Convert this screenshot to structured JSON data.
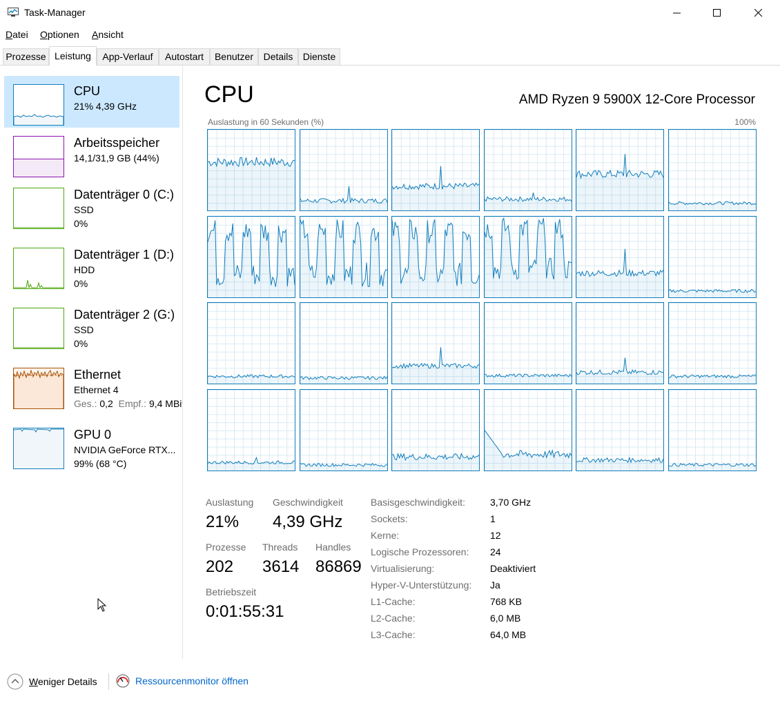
{
  "window": {
    "title": "Task-Manager"
  },
  "menu": [
    {
      "label": "Datei",
      "u": "D",
      "rest": "atei"
    },
    {
      "label": "Optionen",
      "u": "O",
      "rest": "ptionen"
    },
    {
      "label": "Ansicht",
      "u": "A",
      "rest": "nsicht"
    }
  ],
  "tabs": [
    "Prozesse",
    "Leistung",
    "App-Verlauf",
    "Autostart",
    "Benutzer",
    "Details",
    "Dienste"
  ],
  "active_tab": "Leistung",
  "sidebar": {
    "items": [
      {
        "title": "CPU",
        "line1": "21% 4,39 GHz",
        "color": "#117dbb"
      },
      {
        "title": "Arbeitsspeicher",
        "line1": "14,1/31,9 GB (44%)",
        "color": "#8b12ae"
      },
      {
        "title": "Datenträger 0 (C:)",
        "line1": "SSD",
        "line2": "0%",
        "color": "#4da60c"
      },
      {
        "title": "Datenträger 1 (D:)",
        "line1": "HDD",
        "line2": "0%",
        "color": "#4da60c"
      },
      {
        "title": "Datenträger 2 (G:)",
        "line1": "SSD",
        "line2": "0%",
        "color": "#4da60c"
      },
      {
        "title": "Ethernet",
        "line1": "Ethernet 4",
        "line2a": "Ges.: ",
        "line2b": "0,2",
        "line2c": "  Empf.: ",
        "line2d": "9,4 MBit",
        "color": "#a74f01"
      },
      {
        "title": "GPU 0",
        "line1": "NVIDIA GeForce RTX...",
        "line2": "99% (68 °C)",
        "color": "#117dbb"
      }
    ]
  },
  "main": {
    "title": "CPU",
    "processor": "AMD Ryzen 9 5900X 12-Core Processor",
    "graph_label": "Auslastung in 60 Sekunden (%)",
    "graph_max": "100%",
    "accent": "#117dbb"
  },
  "stats": {
    "usage_label": "Auslastung",
    "usage": "21%",
    "speed_label": "Geschwindigkeit",
    "speed": "4,39 GHz",
    "proc_label": "Prozesse",
    "proc": "202",
    "threads_label": "Threads",
    "threads": "3614",
    "handles_label": "Handles",
    "handles": "86869",
    "uptime_label": "Betriebszeit",
    "uptime": "0:01:55:31"
  },
  "details": [
    {
      "k": "Basisgeschwindigkeit:",
      "v": "3,70 GHz"
    },
    {
      "k": "Sockets:",
      "v": "1"
    },
    {
      "k": "Kerne:",
      "v": "12"
    },
    {
      "k": "Logische Prozessoren:",
      "v": "24"
    },
    {
      "k": "Virtualisierung:",
      "v": "Deaktiviert"
    },
    {
      "k": "Hyper-V-Unterstützung:",
      "v": "Ja"
    },
    {
      "k": "L1-Cache:",
      "v": "768 KB"
    },
    {
      "k": "L2-Cache:",
      "v": "6,0 MB"
    },
    {
      "k": "L3-Cache:",
      "v": "64,0 MB"
    }
  ],
  "footer": {
    "less_details": "Weniger Details",
    "less_u": "W",
    "less_rest": "eniger Details",
    "resmon": "Ressourcenmonitor öffnen"
  },
  "core_levels": [
    {
      "base": 60,
      "noise": 6,
      "spike": null
    },
    {
      "base": 12,
      "noise": 3,
      "spike": 30
    },
    {
      "base": 30,
      "noise": 4,
      "spike": 55
    },
    {
      "base": 14,
      "noise": 3,
      "spike": 22
    },
    {
      "base": 45,
      "noise": 5,
      "spike": 70
    },
    {
      "base": 9,
      "noise": 2,
      "spike": null
    },
    {
      "base": 55,
      "noise": 30,
      "spike": null,
      "wave": true
    },
    {
      "base": 55,
      "noise": 30,
      "spike": null,
      "wave": true
    },
    {
      "base": 55,
      "noise": 30,
      "spike": null,
      "wave": true
    },
    {
      "base": 60,
      "noise": 28,
      "spike": null,
      "wave": true
    },
    {
      "base": 30,
      "noise": 4,
      "spike": 60
    },
    {
      "base": 8,
      "noise": 2,
      "spike": null
    },
    {
      "base": 9,
      "noise": 2,
      "spike": null
    },
    {
      "base": 7,
      "noise": 2,
      "spike": null
    },
    {
      "base": 22,
      "noise": 3,
      "spike": 45
    },
    {
      "base": 10,
      "noise": 2,
      "spike": null
    },
    {
      "base": 14,
      "noise": 3,
      "spike": 32
    },
    {
      "base": 9,
      "noise": 2,
      "spike": null
    },
    {
      "base": 10,
      "noise": 2,
      "spike": 16
    },
    {
      "base": 7,
      "noise": 2,
      "spike": null
    },
    {
      "base": 17,
      "noise": 4,
      "spike": null
    },
    {
      "base": 20,
      "noise": 5,
      "spike": 50,
      "decay": true
    },
    {
      "base": 13,
      "noise": 3,
      "spike": null
    },
    {
      "base": 7,
      "noise": 2,
      "spike": null
    }
  ]
}
